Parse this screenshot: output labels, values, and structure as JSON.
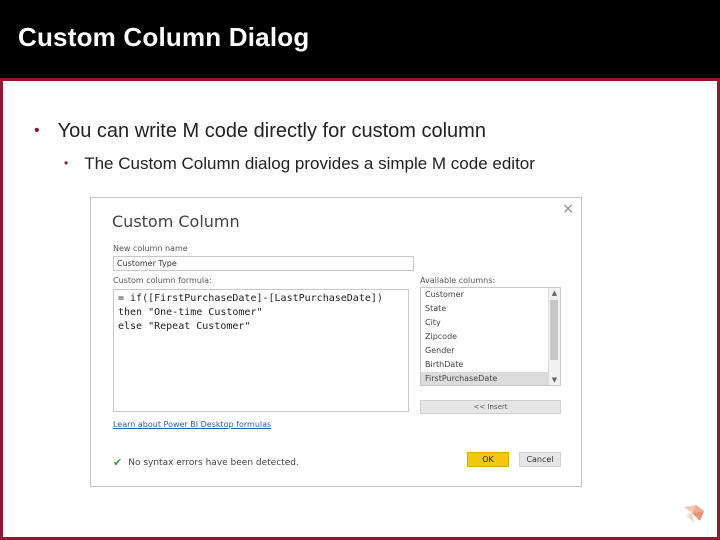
{
  "slide": {
    "title": "Custom Column Dialog",
    "bullet_1": "You can write M code directly for custom column",
    "bullet_2": "The Custom Column dialog provides a simple M code editor",
    "bullet_char": "•"
  },
  "dialog": {
    "title": "Custom Column",
    "close_glyph": "×",
    "new_column_name_label": "New column name",
    "new_column_name_value": "Customer Type",
    "formula_label": "Custom column formula:",
    "formula_lines": [
      "= if([FirstPurchaseDate]-[LastPurchaseDate])",
      "then \"One-time Customer\"",
      "else \"Repeat Customer\""
    ],
    "available_columns_label": "Available columns:",
    "available_columns": [
      "Customer",
      "State",
      "City",
      "Zipcode",
      "Gender",
      "BirthDate",
      "FirstPurchaseDate"
    ],
    "selected_column": "FirstPurchaseDate",
    "insert_label": "<< Insert",
    "learn_link": "Learn about Power BI Desktop formulas",
    "status_text": "No syntax errors have been detected.",
    "ok_label": "OK",
    "cancel_label": "Cancel"
  },
  "colors": {
    "header_bg": "#000000",
    "accent": "#8b1a2e",
    "ok_button": "#f2c811",
    "check": "#3c9a3c"
  },
  "icons": {
    "close": "close-icon",
    "check": "check-icon",
    "logo": "corner-logo-icon"
  }
}
